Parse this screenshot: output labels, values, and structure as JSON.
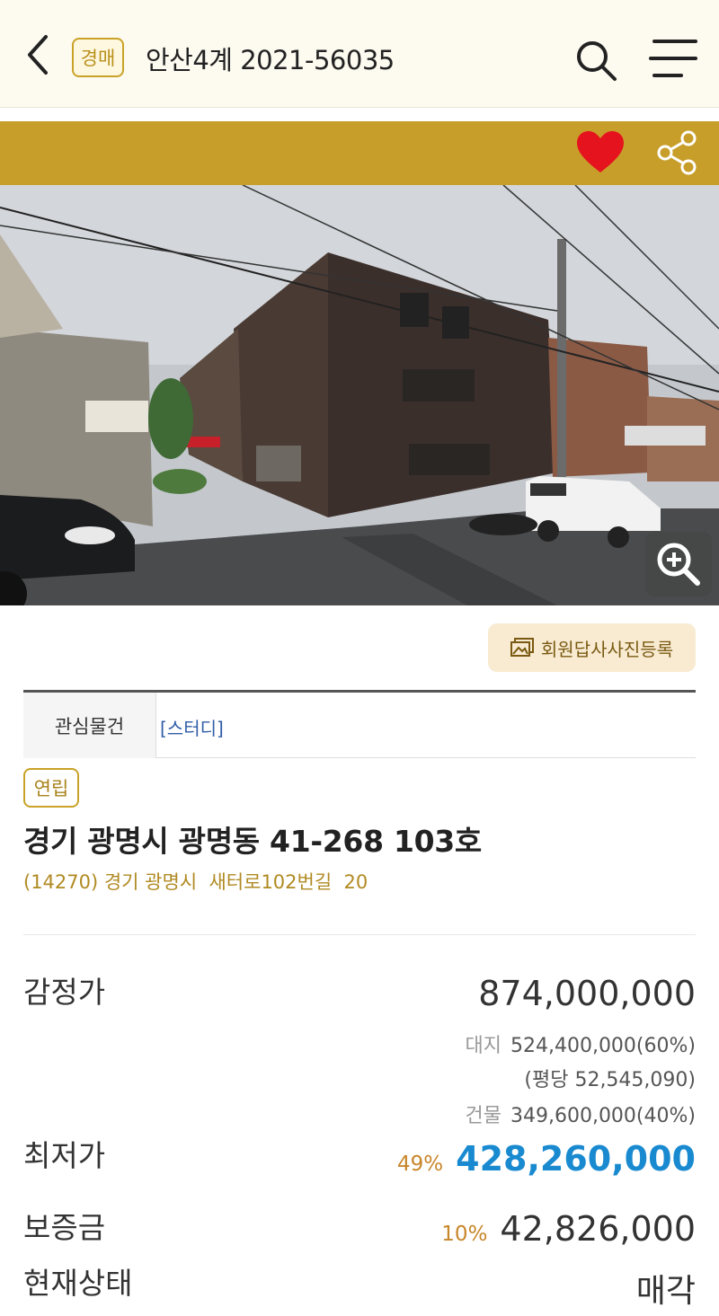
{
  "header": {
    "type_badge": "경매",
    "case_title": "안산4계 2021-56035"
  },
  "photo_upload_button": "회원답사사진등록",
  "tabs": {
    "watch": "관심물건",
    "study": "[스터디]"
  },
  "property": {
    "kind_badge": "연립",
    "address": "경기 광명시 광명동 41-268 103호",
    "road_address": "(14270) 경기 광명시  새터로102번길  20"
  },
  "appraisal": {
    "label": "감정가",
    "value": "874,000,000",
    "land_label": "대지",
    "land_value": "524,400,000(60%)",
    "per_pyeong": "(평당 52,545,090)",
    "building_label": "건물",
    "building_value": "349,600,000(40%)"
  },
  "minimum": {
    "label": "최저가",
    "percent": "49%",
    "value": "428,260,000"
  },
  "deposit": {
    "label": "보증금",
    "percent": "10%",
    "value": "42,826,000"
  },
  "status": {
    "label": "현재상태",
    "value": "매각"
  },
  "colors": {
    "gold": "#c89e2a",
    "heart": "#e5131d",
    "min_price": "#1a8ad0",
    "percent": "#c8862a"
  },
  "icons": [
    "back-icon",
    "search-icon",
    "menu-icon",
    "heart-icon",
    "share-icon",
    "zoom-in-icon",
    "photo-icon"
  ]
}
